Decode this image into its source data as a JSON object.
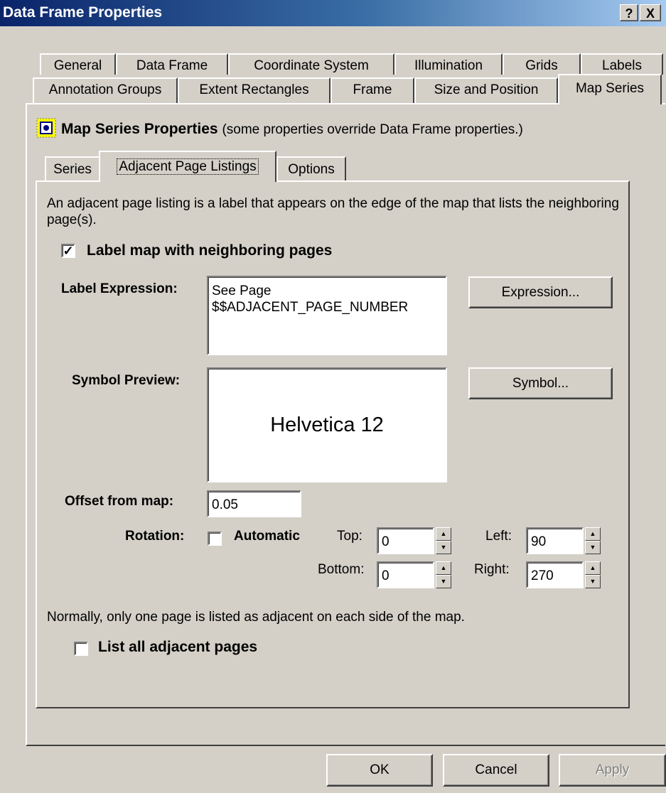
{
  "window": {
    "title": "Data Frame Properties",
    "help_label": "?",
    "close_label": "X"
  },
  "tabs": {
    "row1": [
      "General",
      "Data Frame",
      "Coordinate System",
      "Illumination",
      "Grids",
      "Labels"
    ],
    "row2": [
      "Annotation Groups",
      "Extent Rectangles",
      "Frame",
      "Size and Position",
      "Map Series"
    ],
    "active": "Map Series"
  },
  "map_series": {
    "icon": "map-series-icon",
    "heading": "Map Series Properties",
    "heading_note": "(some properties override Data Frame properties.)",
    "subtabs": [
      "Series",
      "Adjacent Page Listings",
      "Options"
    ],
    "active_subtab": "Adjacent Page Listings"
  },
  "adjacent": {
    "description": "An adjacent page listing is a label that appears on the edge of the map that lists the neighboring page(s).",
    "label_checkbox": {
      "label": "Label map with neighboring pages",
      "checked": true
    },
    "label_expression": {
      "label": "Label Expression:",
      "line1": "See Page",
      "line2": "$$ADJACENT_PAGE_NUMBER",
      "button": "Expression..."
    },
    "symbol_preview": {
      "label": "Symbol Preview:",
      "preview_text": "Helvetica  12",
      "button": "Symbol..."
    },
    "offset": {
      "label": "Offset from map:",
      "value": "0.05"
    },
    "rotation": {
      "label": "Rotation:",
      "automatic_label": "Automatic",
      "automatic_checked": false,
      "top_label": "Top:",
      "top_value": "0",
      "bottom_label": "Bottom:",
      "bottom_value": "0",
      "left_label": "Left:",
      "left_value": "90",
      "right_label": "Right:",
      "right_value": "270"
    },
    "normally_note": "Normally, only one page is listed as adjacent on each side of the map.",
    "list_all": {
      "label": "List all adjacent pages",
      "checked": false
    }
  },
  "footer": {
    "ok": "OK",
    "cancel": "Cancel",
    "apply": "Apply"
  }
}
